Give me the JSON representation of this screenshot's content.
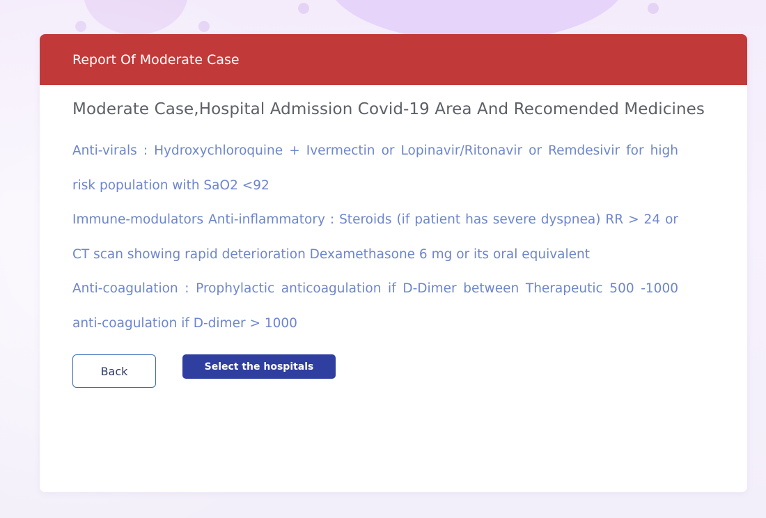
{
  "card": {
    "header_title": "Report Of Moderate Case",
    "heading": "Moderate Case,Hospital Admission Covid-19 Area And Recomended Medicines",
    "paragraphs": [
      "Anti-virals : Hydroxychloroquine + Ivermectin or Lopinavir/Ritonavir or Remdesivir for high risk population with SaO2 <92",
      "Immune-modulators Anti-inflammatory : Steroids (if patient has severe dyspnea) RR > 24 or CT scan showing rapid deterioration Dexamethasone 6 mg or its oral equivalent",
      "Anti-coagulation : Prophylactic anticoagulation if D-Dimer between Therapeutic 500 -1000 anti-coagulation if D-dimer > 1000"
    ]
  },
  "buttons": {
    "back_label": "Back",
    "select_label": "Select the hospitals"
  },
  "colors": {
    "header_bg": "#c13a39",
    "body_text": "#6d86cc",
    "primary_button": "#2f3fa0",
    "back_border": "#3d6ab8"
  }
}
